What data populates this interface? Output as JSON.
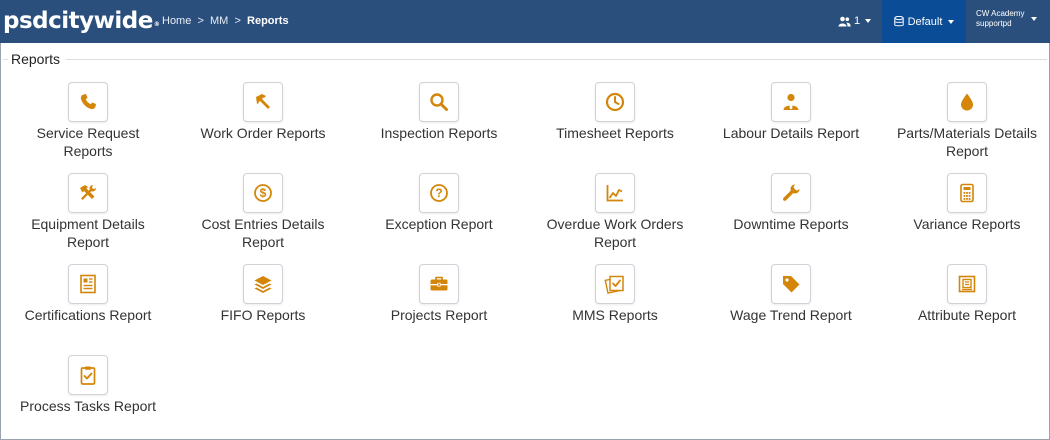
{
  "header": {
    "logo_text": "psdcitywide",
    "breadcrumbs": [
      "Home",
      "MM",
      "Reports"
    ],
    "users_count": "1",
    "database_label": "Default",
    "account_org": "CW Academy",
    "account_user": "supportpd"
  },
  "page": {
    "title": "Reports"
  },
  "colors": {
    "topbar": "#2a4f7c",
    "accent": "#d4860a",
    "db_button": "#0b4c97"
  },
  "reports": [
    {
      "label": "Service Request\nReports",
      "icon": "phone-icon"
    },
    {
      "label": "Work Order Reports",
      "icon": "hammer-icon"
    },
    {
      "label": "Inspection Reports",
      "icon": "magnifier-icon"
    },
    {
      "label": "Timesheet Reports",
      "icon": "clock-icon"
    },
    {
      "label": "Labour Details Report",
      "icon": "worker-icon"
    },
    {
      "label": "Parts/Materials Details\nReport",
      "icon": "drop-icon"
    },
    {
      "label": "Equipment Details\nReport",
      "icon": "tools-icon"
    },
    {
      "label": "Cost Entries Details\nReport",
      "icon": "dollar-icon"
    },
    {
      "label": "Exception Report",
      "icon": "question-icon"
    },
    {
      "label": "Overdue Work Orders\nReport",
      "icon": "line-chart-icon"
    },
    {
      "label": "Downtime Reports",
      "icon": "wrench-icon"
    },
    {
      "label": "Variance Reports",
      "icon": "calculator-icon"
    },
    {
      "label": "Certifications Report",
      "icon": "certificate-icon"
    },
    {
      "label": "FIFO Reports",
      "icon": "layers-icon"
    },
    {
      "label": "Projects Report",
      "icon": "briefcase-icon"
    },
    {
      "label": "MMS Reports",
      "icon": "checklist-cards-icon"
    },
    {
      "label": "Wage Trend Report",
      "icon": "tag-icon"
    },
    {
      "label": "Attribute Report",
      "icon": "document-box-icon"
    },
    {
      "label": "Process Tasks Report",
      "icon": "clipboard-check-icon"
    }
  ]
}
